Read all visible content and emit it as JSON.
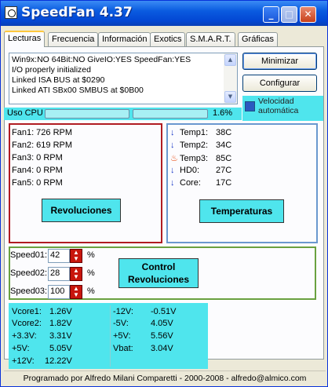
{
  "window": {
    "title": "SpeedFan 4.37"
  },
  "tabs": [
    "Lecturas",
    "Frecuencia",
    "Información",
    "Exotics",
    "S.M.A.R.T.",
    "Gráficas"
  ],
  "log": [
    "Win9x:NO  64Bit:NO  GiveIO:YES  SpeedFan:YES",
    "I/O properly initialized",
    "Linked ISA BUS at $0290",
    "Linked ATI SBx00 SMBUS at $0B00"
  ],
  "buttons": {
    "minimize": "Minimizar",
    "configure": "Configurar"
  },
  "cpu": {
    "label": "Uso CPU",
    "percent": "1.6%"
  },
  "auto_speed": {
    "label_line1": "Velocidad",
    "label_line2": "automática",
    "checked": false
  },
  "fans": [
    "Fan1: 726 RPM",
    "Fan2: 619 RPM",
    "Fan3: 0 RPM",
    "Fan4: 0 RPM",
    "Fan5: 0 RPM"
  ],
  "fans_badge": "Revoluciones",
  "temps": [
    {
      "label": "Temp1:",
      "value": "38C",
      "icon": "down-arrow-icon"
    },
    {
      "label": "Temp2:",
      "value": "34C",
      "icon": "down-arrow-icon"
    },
    {
      "label": "Temp3:",
      "value": "85C",
      "icon": "flame-icon"
    },
    {
      "label": "HD0:",
      "value": "27C",
      "icon": "down-arrow-icon"
    },
    {
      "label": "Core:",
      "value": "17C",
      "icon": "down-arrow-icon"
    }
  ],
  "temps_badge": "Temperaturas",
  "speeds": [
    {
      "label": "Speed01:",
      "value": "42",
      "unit": "%"
    },
    {
      "label": "Speed02:",
      "value": "28",
      "unit": "%"
    },
    {
      "label": "Speed03:",
      "value": "100",
      "unit": "%"
    }
  ],
  "control_badge": {
    "line1": "Control",
    "line2": "Revoluciones"
  },
  "voltages_left": [
    {
      "label": "Vcore1:",
      "value": "1.26V"
    },
    {
      "label": "Vcore2:",
      "value": "1.82V"
    },
    {
      "label": "+3.3V:",
      "value": "3.31V"
    },
    {
      "label": "+5V:",
      "value": "5.05V"
    },
    {
      "label": "+12V:",
      "value": "12.22V"
    }
  ],
  "voltages_right": [
    {
      "label": "-12V:",
      "value": "-0.51V"
    },
    {
      "label": "-5V:",
      "value": "4.05V"
    },
    {
      "label": "+5V:",
      "value": "5.56V"
    },
    {
      "label": "Vbat:",
      "value": "3.04V"
    }
  ],
  "footer": "Programado por Alfredo Milani Comparetti - 2000-2008 - alfredo@almico.com",
  "colors": {
    "accent_cyan": "#4fe5ed",
    "title_blue": "#0a5be0",
    "fan_border": "#b01c22",
    "temp_border": "#6a98cf",
    "control_border": "#6aa140"
  }
}
